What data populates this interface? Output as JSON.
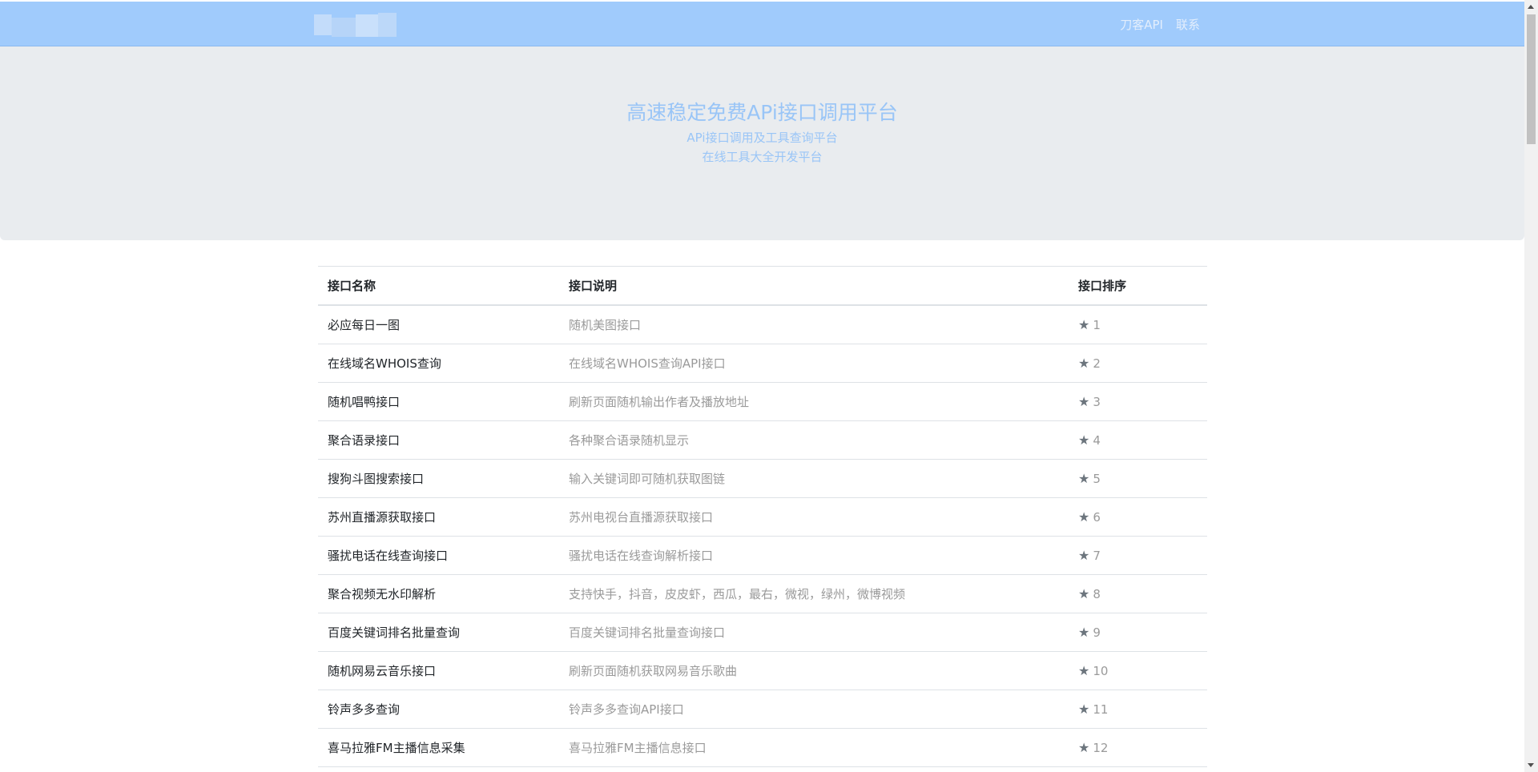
{
  "navbar": {
    "links": [
      "刀客API",
      "联系"
    ],
    "background": "#a0cbfc"
  },
  "hero": {
    "title": "高速稳定免费APi接口调用平台",
    "subtitle_1": "APi接口调用及工具查询平台",
    "subtitle_2": "在线工具大全开发平台",
    "text_color": "#99c5f7"
  },
  "table": {
    "headers": [
      "接口名称",
      "接口说明",
      "接口排序"
    ],
    "rows": [
      {
        "name": "必应每日一图",
        "desc": "随机美图接口",
        "rank": "1"
      },
      {
        "name": "在线域名WHOIS查询",
        "desc": "在线域名WHOIS查询API接口",
        "rank": "2"
      },
      {
        "name": "随机唱鸭接口",
        "desc": "刷新页面随机输出作者及播放地址",
        "rank": "3"
      },
      {
        "name": "聚合语录接口",
        "desc": "各种聚合语录随机显示",
        "rank": "4"
      },
      {
        "name": "搜狗斗图搜索接口",
        "desc": "输入关键词即可随机获取图链",
        "rank": "5"
      },
      {
        "name": "苏州直播源获取接口",
        "desc": "苏州电视台直播源获取接口",
        "rank": "6"
      },
      {
        "name": "骚扰电话在线查询接口",
        "desc": "骚扰电话在线查询解析接口",
        "rank": "7"
      },
      {
        "name": "聚合视频无水印解析",
        "desc": "支持快手，抖音，皮皮虾，西瓜，最右，微视，绿州，微博视频",
        "rank": "8"
      },
      {
        "name": "百度关键词排名批量查询",
        "desc": "百度关键词排名批量查询接口",
        "rank": "9"
      },
      {
        "name": "随机网易云音乐接口",
        "desc": "刷新页面随机获取网易音乐歌曲",
        "rank": "10"
      },
      {
        "name": "铃声多多查询",
        "desc": "铃声多多查询API接口",
        "rank": "11"
      },
      {
        "name": "喜马拉雅FM主播信息采集",
        "desc": "喜马拉雅FM主播信息接口",
        "rank": "12"
      }
    ],
    "rank_icon": "star-icon"
  }
}
